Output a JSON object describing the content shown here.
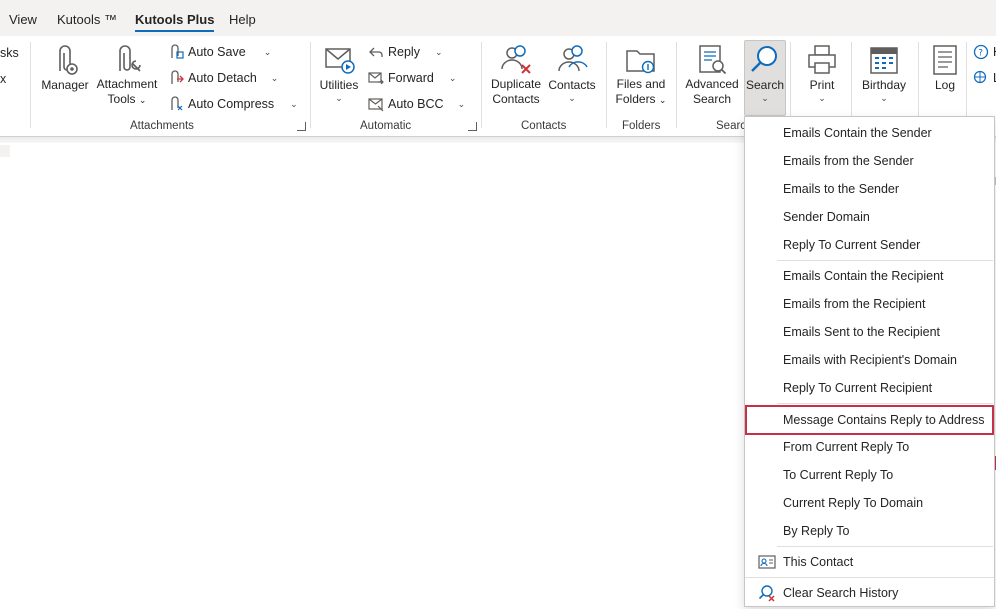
{
  "tabs": [
    {
      "label": "View",
      "active": false
    },
    {
      "label": "Kutools ™",
      "active": false
    },
    {
      "label": "Kutools Plus",
      "active": true
    },
    {
      "label": "Help",
      "active": false
    }
  ],
  "left_stub": {
    "line1": "sks",
    "line2": "x"
  },
  "groups": {
    "attachments": {
      "label": "Attachments",
      "manager": "Manager",
      "attachment_tools": {
        "line1": "Attachment",
        "line2": "Tools"
      },
      "auto_save": "Auto Save",
      "auto_detach": "Auto Detach",
      "auto_compress": "Auto Compress"
    },
    "automatic": {
      "label": "Automatic",
      "utilities": "Utilities",
      "reply": "Reply",
      "forward": "Forward",
      "auto_bcc": "Auto BCC"
    },
    "contacts": {
      "label": "Contacts",
      "duplicate_contacts": {
        "line1": "Duplicate",
        "line2": "Contacts"
      },
      "contacts": "Contacts"
    },
    "folders": {
      "label": "Folders",
      "files_and_folders": {
        "line1": "Files and",
        "line2": "Folders"
      }
    },
    "search": {
      "label": "Searc",
      "advanced_search": {
        "line1": "Advanced",
        "line2": "Search"
      },
      "search": "Search"
    },
    "print": {
      "label": "Print"
    },
    "birthday": {
      "label": "Birthday"
    },
    "log": {
      "label": "Log"
    }
  },
  "right_stub": {
    "line1": "H",
    "line2": "L"
  },
  "search_menu": {
    "items": [
      "Emails Contain the Sender",
      "Emails from the Sender",
      "Emails to the Sender",
      "Sender Domain",
      "Reply To Current Sender",
      "Emails Contain the Recipient",
      "Emails from the Recipient",
      "Emails Sent to the Recipient",
      "Emails with Recipient's Domain",
      "Reply To Current Recipient",
      "Message Contains Reply to Address",
      "From Current Reply To",
      "To Current Reply To",
      "Current Reply To Domain",
      "By Reply To",
      "This Contact",
      "Clear Search History"
    ],
    "highlighted": "Message Contains Reply to Address",
    "highlight_color": "#c4314b"
  },
  "colors": {
    "accent": "#0f6cbd",
    "icon_blue": "#0f6cbd",
    "icon_red": "#d13438"
  }
}
